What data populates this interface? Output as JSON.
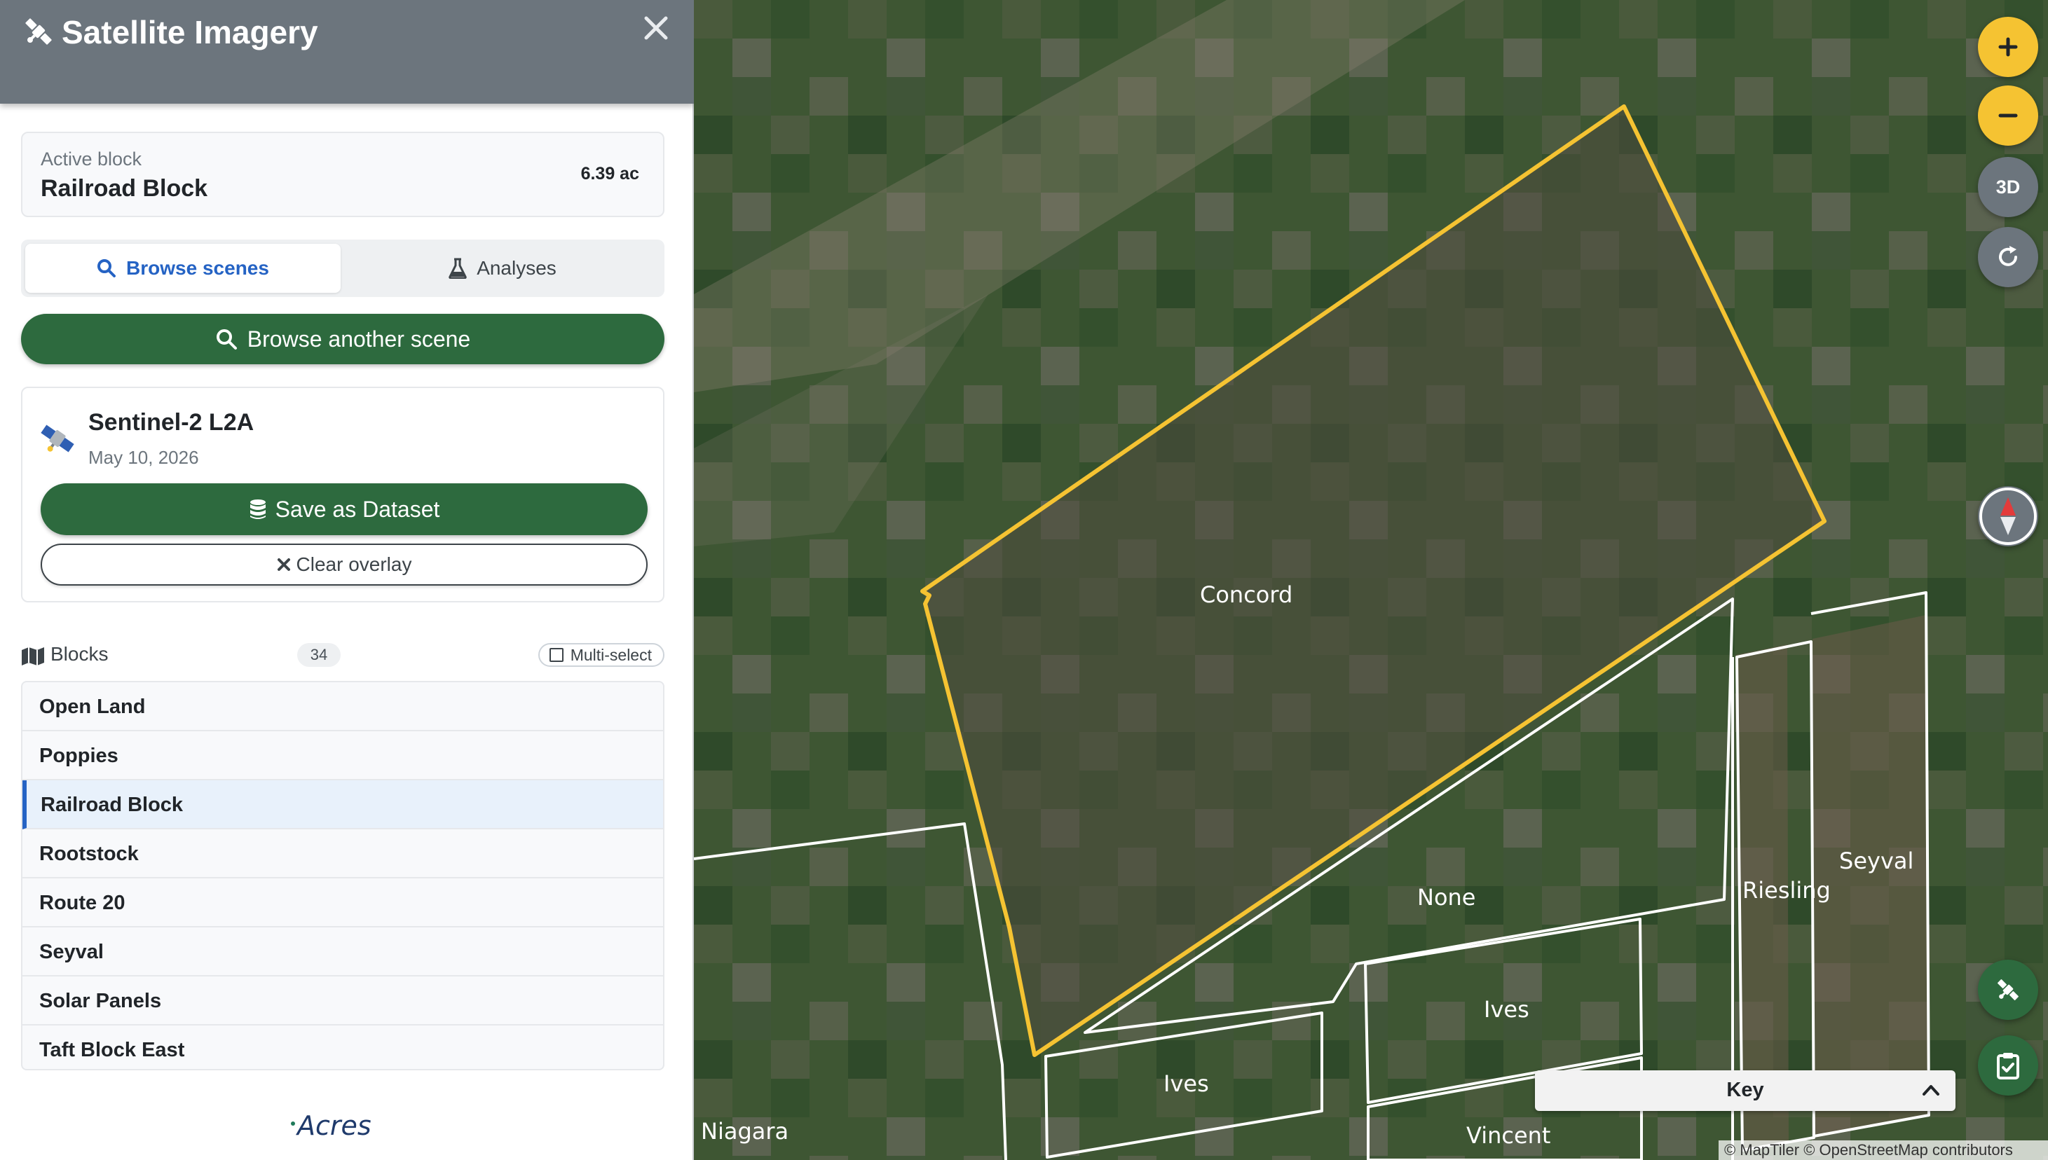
{
  "panel": {
    "title": "Satellite Imagery",
    "title_icon": "satellite-icon",
    "close_icon": "close-icon"
  },
  "active_block": {
    "label": "Active block",
    "name": "Railroad Block",
    "area": "6.39 ac"
  },
  "tabs": [
    {
      "label": "Browse scenes",
      "icon": "search-icon",
      "active": true
    },
    {
      "label": "Analyses",
      "icon": "flask-icon",
      "active": false
    }
  ],
  "browse_another_label": "Browse another scene",
  "scene": {
    "name": "Sentinel-2 L2A",
    "date": "May 10, 2026",
    "save_label": "Save as Dataset",
    "clear_label": "Clear overlay"
  },
  "blocks": {
    "title": "Blocks",
    "count": "34",
    "multi_select_label": "Multi-select",
    "items": [
      {
        "label": "Open Land",
        "active": false
      },
      {
        "label": "Poppies",
        "active": false
      },
      {
        "label": "Railroad Block",
        "active": true
      },
      {
        "label": "Rootstock",
        "active": false
      },
      {
        "label": "Route 20",
        "active": false
      },
      {
        "label": "Seyval",
        "active": false
      },
      {
        "label": "Solar Panels",
        "active": false
      },
      {
        "label": "Taft Block East",
        "active": false
      }
    ]
  },
  "brand": "Acres",
  "map": {
    "labels": {
      "concord": "Concord",
      "none": "None",
      "riesling": "Riesling",
      "seyval": "Seyval",
      "ives_right": "Ives",
      "ives_left": "Ives",
      "vincent": "Vincent",
      "niagara": "Niagara"
    },
    "buttons": {
      "zoom_in": "+",
      "zoom_out": "−",
      "view_3d": "3D"
    },
    "key_label": "Key",
    "attribution": "© MapTiler © OpenStreetMap contributors",
    "colors": {
      "selected_outline": "#f5c332",
      "block_outline": "#ffffff",
      "accent_green": "#2d6a3e",
      "accent_blue": "#2563c4"
    }
  }
}
